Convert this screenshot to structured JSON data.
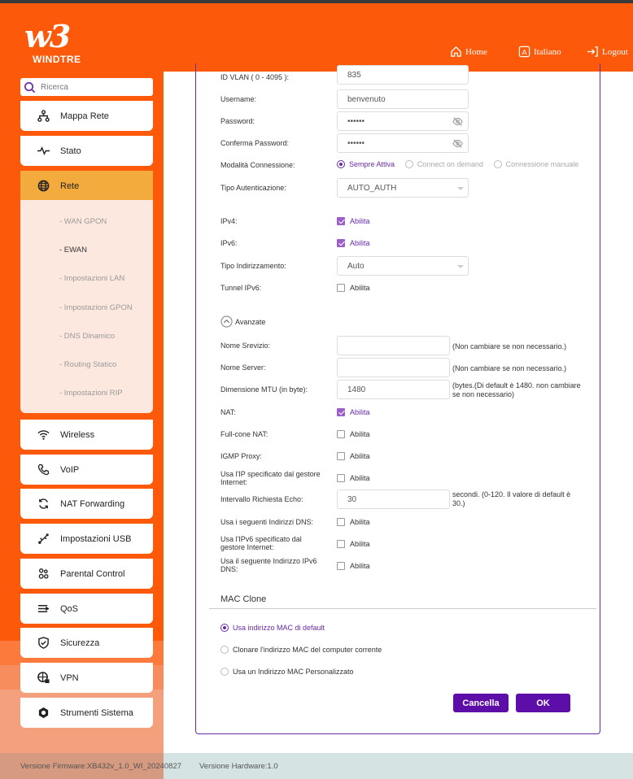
{
  "header": {
    "brand": "WINDTRE",
    "home": "Home",
    "language": "Italiano",
    "logout": "Logout"
  },
  "sidebar": {
    "search_placeholder": "Ricerca",
    "items": [
      {
        "label": "Mappa Rete"
      },
      {
        "label": "Stato"
      },
      {
        "label": "Rete"
      },
      {
        "label": "Wireless"
      },
      {
        "label": "VoIP"
      },
      {
        "label": "NAT Forwarding"
      },
      {
        "label": "Impostazioni USB"
      },
      {
        "label": "Parental Control"
      },
      {
        "label": "QoS"
      },
      {
        "label": "Sicurezza"
      },
      {
        "label": "VPN"
      },
      {
        "label": "Strumenti Sistema"
      }
    ],
    "submenu": [
      {
        "label": "- WAN GPON"
      },
      {
        "label": "- EWAN"
      },
      {
        "label": "- Impostazioni LAN"
      },
      {
        "label": "- Impostazioni GPON"
      },
      {
        "label": "- DNS Dinamico"
      },
      {
        "label": "- Routing Statico"
      },
      {
        "label": "- Impostazioni RIP"
      }
    ]
  },
  "form": {
    "vlan_label": "ID VLAN ( 0 - 4095 ):",
    "vlan_value": "835",
    "username_label": "Username:",
    "username_value": "benvenuto",
    "password_label": "Password:",
    "password_value": "••••••",
    "confirm_label": "Conferma Password:",
    "confirm_value": "••••••",
    "mode_label": "Modalità Connessione:",
    "mode_options": [
      "Sempre Attiva",
      "Connect on demand",
      "Connessione manuale"
    ],
    "auth_label": "Tipo Autenticazione:",
    "auth_value": "AUTO_AUTH",
    "ipv4_label": "IPv4:",
    "ipv6_label": "IPv6:",
    "addr_label": "Tipo Indirizzamento:",
    "addr_value": "Auto",
    "tunnel_label": "Tunnel IPv6:",
    "enable": "Abilita",
    "advanced": "Avanzate",
    "service_label": "Nome Srevizio:",
    "service_note": "(Non cambiare se non necessario.)",
    "server_label": "Nome Server:",
    "server_note": "(Non cambiare se non necessario.)",
    "mtu_label": "Dimensione MTU (in byte):",
    "mtu_value": "1480",
    "mtu_note": "(bytes.(Di default è 1480. non cambiare se non necessario)",
    "nat_label": "NAT:",
    "fullcone_label": "Full-cone NAT:",
    "igmp_label": "IGMP Proxy:",
    "isp_ip_label": "Usa l'IP specificato dal gestore Internet:",
    "echo_label": "Intervallo Richiesta Echo:",
    "echo_value": "30",
    "echo_note": "secondi. (0-120. Il valore di default è 30.)",
    "dns_label": "Usa i seguenti Indirizzi DNS:",
    "isp_ipv6_label": "Usa l'IPv6 specificato dal gestore Internet:",
    "ipv6_dns_label": "Usa il seguente Indirizzo IPv6 DNS:"
  },
  "mac": {
    "title": "MAC Clone",
    "options": [
      "Usa indirizzo MAC di default",
      "Clonare l'indirizzo MAC del computer corrente",
      "Usa un Indirizzo MAC Personalizzato"
    ]
  },
  "buttons": {
    "cancel": "Cancella",
    "ok": "OK"
  },
  "footer": {
    "firmware": "Versione Firmware:XB432v_1.0_WI_20240827",
    "hardware": "Versione Hardware:1.0"
  }
}
